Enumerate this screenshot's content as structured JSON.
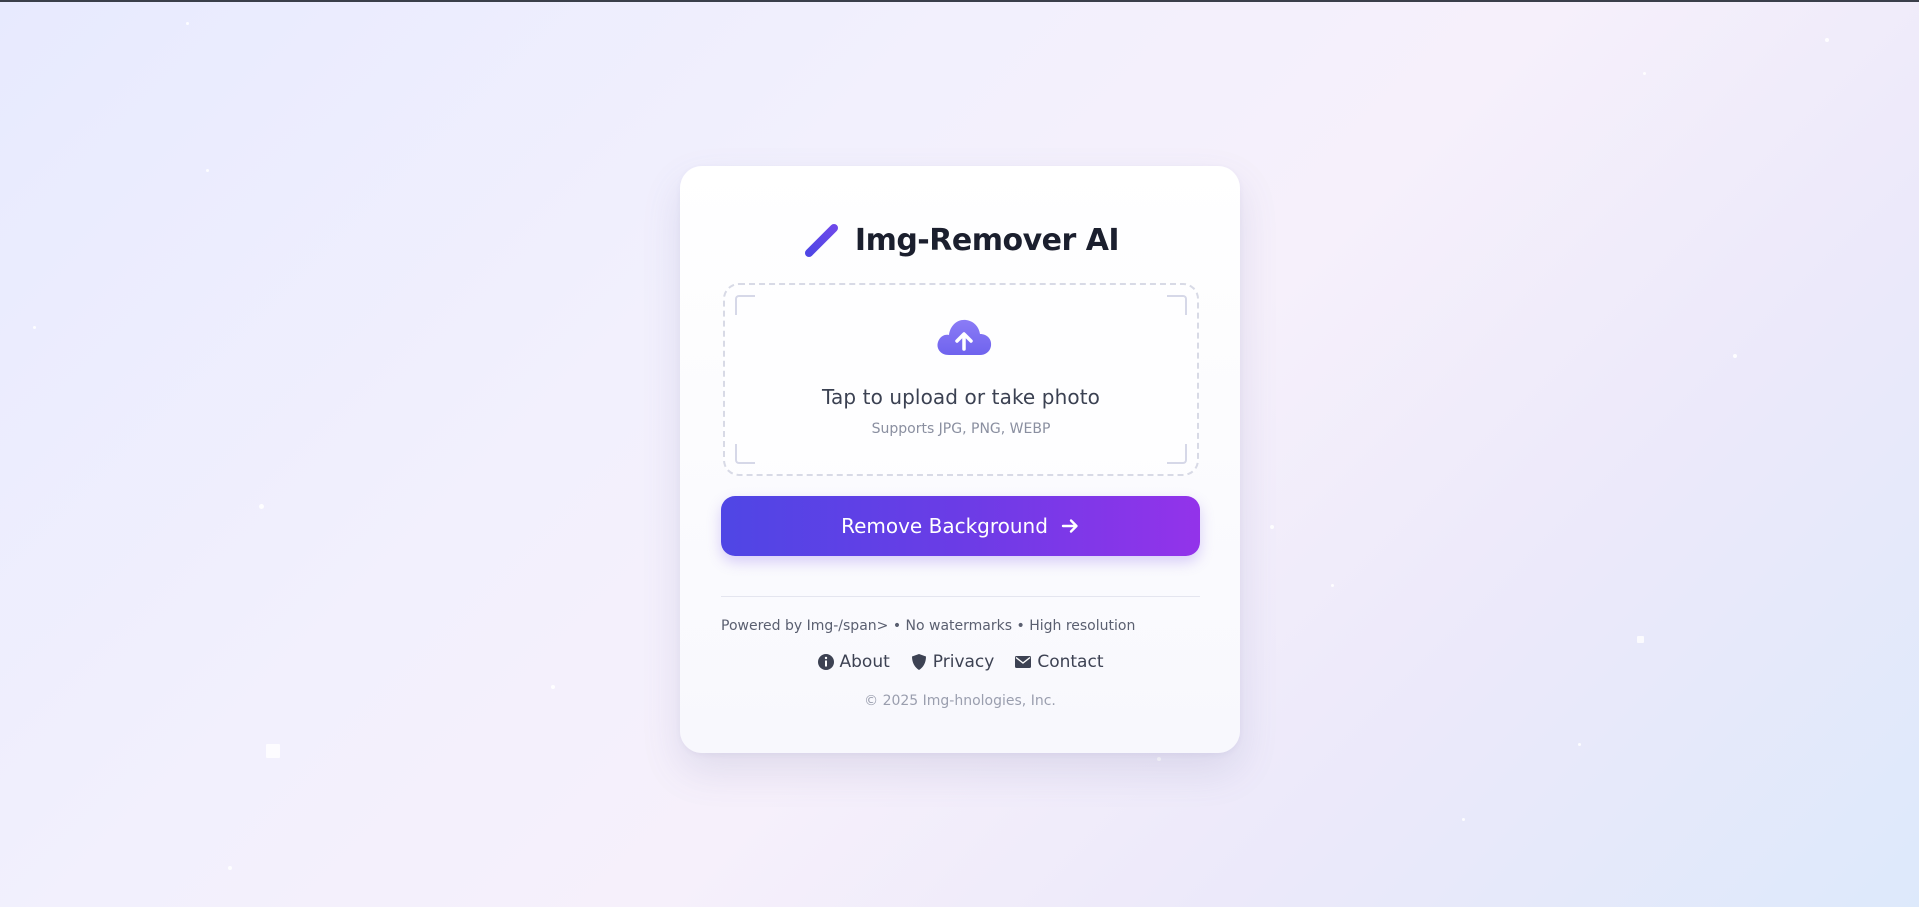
{
  "app": {
    "title": "Img-Remover AI",
    "icon": "magic-wand-icon",
    "accent_color": "#4f46e5",
    "accent_end_color": "#9333ea"
  },
  "upload": {
    "icon": "cloud-upload-icon",
    "title": "Tap to upload or take photo",
    "subtitle": "Supports JPG, PNG, WEBP"
  },
  "action": {
    "label": "Remove Background",
    "icon": "arrow-right-icon"
  },
  "footer": {
    "powered_text": "Powered by Img-/span> • No watermarks • High resolution",
    "links": [
      {
        "label": "About",
        "icon": "info-circle-icon"
      },
      {
        "label": "Privacy",
        "icon": "shield-icon"
      },
      {
        "label": "Contact",
        "icon": "envelope-icon"
      }
    ],
    "copyright": "© 2025 Img-hnologies, Inc."
  }
}
